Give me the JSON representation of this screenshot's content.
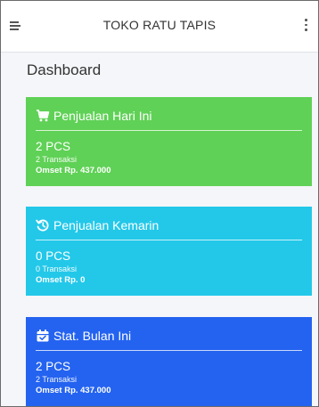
{
  "app": {
    "title": "TOKO RATU TAPIS"
  },
  "page": {
    "title": "Dashboard"
  },
  "cards": [
    {
      "title": "Penjualan Hari Ini",
      "icon": "cart-icon",
      "qty": "2 PCS",
      "transactions": "2 Transaksi",
      "omset": "Omset Rp. 437.000",
      "color": "#5fd156"
    },
    {
      "title": "Penjualan Kemarin",
      "icon": "history-icon",
      "qty": "0 PCS",
      "transactions": "0 Transaksi",
      "omset": "Omset Rp. 0",
      "color": "#23c8e9"
    },
    {
      "title": "Stat. Bulan Ini",
      "icon": "calendar-icon",
      "qty": "2 PCS",
      "transactions": "2 Transaksi",
      "omset": "Omset Rp. 437.000",
      "color": "#2463f0"
    }
  ]
}
